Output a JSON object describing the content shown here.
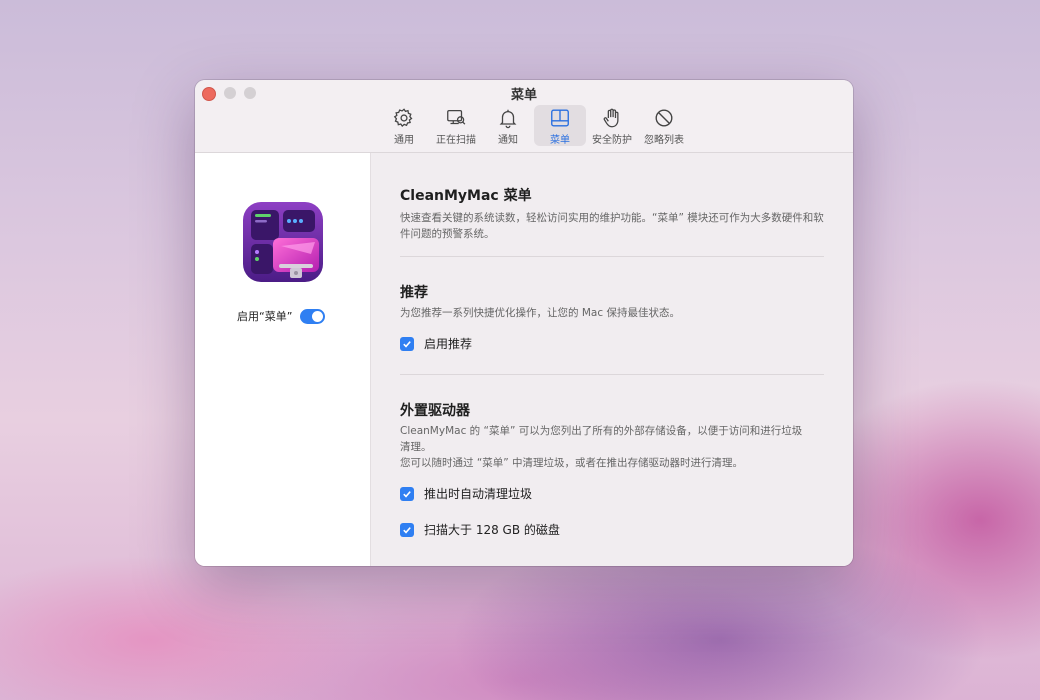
{
  "window": {
    "title": "菜单"
  },
  "toolbar": {
    "items": [
      {
        "label": "通用",
        "icon": "gear-icon"
      },
      {
        "label": "正在扫描",
        "icon": "scan-icon"
      },
      {
        "label": "通知",
        "icon": "bell-icon"
      },
      {
        "label": "菜单",
        "icon": "menu-icon",
        "active": true
      },
      {
        "label": "安全防护",
        "icon": "hand-icon"
      },
      {
        "label": "忽略列表",
        "icon": "ignore-icon"
      }
    ]
  },
  "sidebar": {
    "enable_label": "启用“菜单”",
    "enabled": true
  },
  "sections": {
    "intro": {
      "title": "CleanMyMac 菜单",
      "desc": "快速查看关键的系统读数，轻松访问实用的维护功能。“菜单” 模块还可作为大多数硬件和软件问题的预警系统。"
    },
    "recommend": {
      "title": "推荐",
      "desc": "为您推荐一系列快捷优化操作，让您的 Mac 保持最佳状态。",
      "checkbox": {
        "label": "启用推荐",
        "checked": true
      }
    },
    "drives": {
      "title": "外置驱动器",
      "desc1": "CleanMyMac 的 “菜单” 可以为您列出了所有的外部存储设备，以便于访问和进行垃圾清理。",
      "desc2": "您可以随时通过 “菜单” 中清理垃圾，或者在推出存储驱动器时进行清理。",
      "checkbox1": {
        "label": "推出时自动清理垃圾",
        "checked": true
      },
      "checkbox2": {
        "label": "扫描大于 128 GB 的磁盘",
        "checked": true
      }
    }
  },
  "colors": {
    "accent": "#2f7ff2",
    "close": "#ed6a5e"
  }
}
